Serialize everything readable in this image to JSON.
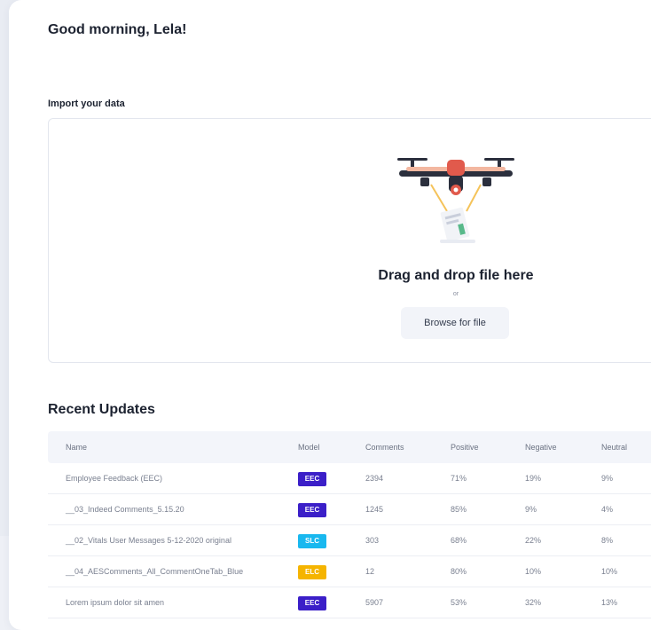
{
  "greeting": "Good morning, Lela!",
  "import": {
    "label": "Import your data",
    "drop_title": "Drag and drop file here",
    "or": "or",
    "browse_label": "Browse for file"
  },
  "recent": {
    "title": "Recent Updates",
    "columns": {
      "name": "Name",
      "model": "Model",
      "comments": "Comments",
      "positive": "Positive",
      "negative": "Negative",
      "neutral": "Neutral"
    },
    "rows": [
      {
        "name": "Employee Feedback (EEC)",
        "model": "EEC",
        "comments": "2394",
        "positive": "71%",
        "negative": "19%",
        "neutral": "9%"
      },
      {
        "name": "__03_Indeed Comments_5.15.20",
        "model": "EEC",
        "comments": "1245",
        "positive": "85%",
        "negative": "9%",
        "neutral": "4%"
      },
      {
        "name": "__02_Vitals User Messages 5-12-2020 original",
        "model": "SLC",
        "comments": "303",
        "positive": "68%",
        "negative": "22%",
        "neutral": "8%"
      },
      {
        "name": "__04_AESComments_All_CommentOneTab_Blue",
        "model": "ELC",
        "comments": "12",
        "positive": "80%",
        "negative": "10%",
        "neutral": "10%"
      },
      {
        "name": "Lorem ipsum dolor sit amen",
        "model": "EEC",
        "comments": "5907",
        "positive": "53%",
        "negative": "32%",
        "neutral": "13%"
      }
    ]
  },
  "colors": {
    "EEC": "#3b1fc8",
    "SLC": "#19b8ef",
    "ELC": "#f5b400"
  }
}
